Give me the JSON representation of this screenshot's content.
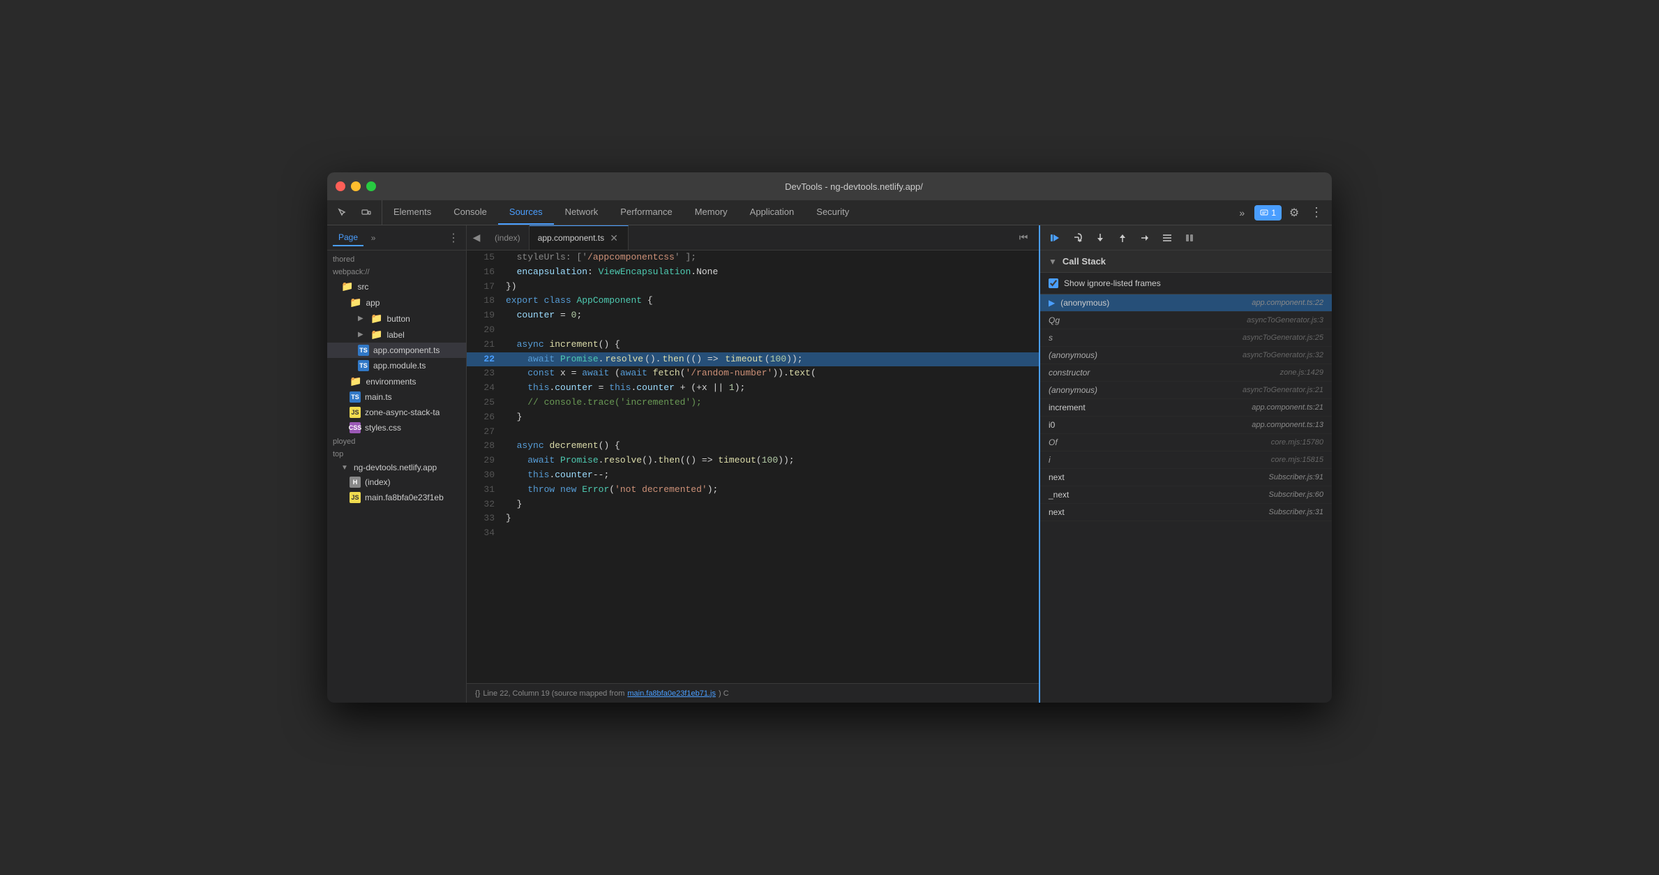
{
  "window": {
    "title": "DevTools - ng-devtools.netlify.app/"
  },
  "traffic_lights": {
    "red": "red",
    "yellow": "yellow",
    "green": "green"
  },
  "devtools": {
    "tabs": [
      {
        "id": "elements",
        "label": "Elements",
        "active": false
      },
      {
        "id": "console",
        "label": "Console",
        "active": false
      },
      {
        "id": "sources",
        "label": "Sources",
        "active": true
      },
      {
        "id": "network",
        "label": "Network",
        "active": false
      },
      {
        "id": "performance",
        "label": "Performance",
        "active": false
      },
      {
        "id": "memory",
        "label": "Memory",
        "active": false
      },
      {
        "id": "application",
        "label": "Application",
        "active": false
      },
      {
        "id": "security",
        "label": "Security",
        "active": false
      }
    ],
    "more_tabs": "»",
    "message_badge": "1",
    "settings_icon": "⚙",
    "more_icon": "⋮"
  },
  "sidebar": {
    "tab_label": "Page",
    "more": "»",
    "menu_icon": "⋮",
    "items": [
      {
        "id": "thored",
        "label": "thored",
        "type": "section",
        "indent": 0
      },
      {
        "id": "webpack",
        "label": "webpack://",
        "type": "section",
        "indent": 0
      },
      {
        "id": "src",
        "label": "src",
        "type": "folder",
        "indent": 1
      },
      {
        "id": "app",
        "label": "app",
        "type": "folder",
        "indent": 2
      },
      {
        "id": "button",
        "label": "button",
        "type": "folder-collapsed",
        "indent": 3
      },
      {
        "id": "label",
        "label": "label",
        "type": "folder-collapsed",
        "indent": 3
      },
      {
        "id": "app-component-ts",
        "label": "app.component.ts",
        "type": "file-ts",
        "indent": 3,
        "active": true
      },
      {
        "id": "app-module-ts",
        "label": "app.module.ts",
        "type": "file-ts",
        "indent": 3
      },
      {
        "id": "environments",
        "label": "environments",
        "type": "folder",
        "indent": 2
      },
      {
        "id": "main-ts",
        "label": "main.ts",
        "type": "file-ts",
        "indent": 2
      },
      {
        "id": "zone-async",
        "label": "zone-async-stack-ta",
        "type": "file-js",
        "indent": 2
      },
      {
        "id": "styles-css",
        "label": "styles.css",
        "type": "file-css",
        "indent": 2
      },
      {
        "id": "ployed",
        "label": "ployed",
        "type": "section",
        "indent": 0
      },
      {
        "id": "top",
        "label": "top",
        "type": "section",
        "indent": 0
      },
      {
        "id": "ng-devtools",
        "label": "ng-devtools.netlify.app",
        "type": "domain",
        "indent": 1
      },
      {
        "id": "index",
        "label": "(index)",
        "type": "file-html",
        "indent": 2
      },
      {
        "id": "main-fa8",
        "label": "main.fa8bfa0e23f1eb",
        "type": "file-js",
        "indent": 2
      }
    ]
  },
  "editor": {
    "tabs": [
      {
        "id": "index",
        "label": "(index)",
        "active": false,
        "closeable": false
      },
      {
        "id": "app-component",
        "label": "app.component.ts",
        "active": true,
        "closeable": true
      }
    ],
    "lines": [
      {
        "num": 15,
        "content": "  styleUrls: ['./appcomponentcss']",
        "type": "comment-partial"
      },
      {
        "num": 16,
        "content": "  encapsulation: ViewEncapsulation.None"
      },
      {
        "num": 17,
        "content": "})"
      },
      {
        "num": 18,
        "content": "export class AppComponent {",
        "keyword": true
      },
      {
        "num": 19,
        "content": "  counter = 0;"
      },
      {
        "num": 20,
        "content": ""
      },
      {
        "num": 21,
        "content": "  async increment() {",
        "keyword": true
      },
      {
        "num": 22,
        "content": "    await Promise.resolve().then(() => timeout(100));",
        "highlighted": true,
        "breakpoint": true
      },
      {
        "num": 23,
        "content": "    const x = await (await fetch('/random-number')).text("
      },
      {
        "num": 24,
        "content": "    this.counter = this.counter + (+x || 1);"
      },
      {
        "num": 25,
        "content": "    // console.trace('incremented');"
      },
      {
        "num": 26,
        "content": "  }"
      },
      {
        "num": 27,
        "content": ""
      },
      {
        "num": 28,
        "content": "  async decrement() {",
        "keyword": true
      },
      {
        "num": 29,
        "content": "    await Promise.resolve().then(() => timeout(100));"
      },
      {
        "num": 30,
        "content": "    this.counter--;"
      },
      {
        "num": 31,
        "content": "    throw new Error('not decremented');"
      },
      {
        "num": 32,
        "content": "  }"
      },
      {
        "num": 33,
        "content": "}"
      },
      {
        "num": 34,
        "content": ""
      }
    ]
  },
  "status_bar": {
    "icon": "{}",
    "text": "Line 22, Column 19 (source mapped from ",
    "link": "main.fa8bfa0e23f1eb71.js",
    "text2": ") C"
  },
  "call_stack": {
    "title": "Call Stack",
    "show_ignore": "Show ignore-listed frames",
    "items": [
      {
        "id": "anonymous-1",
        "name": "(anonymous)",
        "file": "app.component.ts:22",
        "active": true,
        "italic": false
      },
      {
        "id": "qg",
        "name": "Qg",
        "file": "asyncToGenerator.js:3",
        "active": false,
        "italic": true
      },
      {
        "id": "s",
        "name": "s",
        "file": "asyncToGenerator.js:25",
        "active": false,
        "italic": true
      },
      {
        "id": "anonymous-2",
        "name": "(anonymous)",
        "file": "asyncToGenerator.js:32",
        "active": false,
        "italic": true
      },
      {
        "id": "constructor",
        "name": "constructor",
        "file": "zone.js:1429",
        "active": false,
        "italic": true
      },
      {
        "id": "anonymous-3",
        "name": "(anonymous)",
        "file": "asyncToGenerator.js:21",
        "active": false,
        "italic": true
      },
      {
        "id": "increment",
        "name": "increment",
        "file": "app.component.ts:21",
        "active": false,
        "italic": false
      },
      {
        "id": "i0",
        "name": "i0",
        "file": "app.component.ts:13",
        "active": false,
        "italic": false
      },
      {
        "id": "of",
        "name": "Of",
        "file": "core.mjs:15780",
        "active": false,
        "italic": true
      },
      {
        "id": "i",
        "name": "i",
        "file": "core.mjs:15815",
        "active": false,
        "italic": true
      },
      {
        "id": "next-1",
        "name": "next",
        "file": "Subscriber.js:91",
        "active": false,
        "italic": false
      },
      {
        "id": "_next",
        "name": "_next",
        "file": "Subscriber.js:60",
        "active": false,
        "italic": false
      },
      {
        "id": "next-2",
        "name": "next",
        "file": "Subscriber.js:31",
        "active": false,
        "italic": false
      }
    ]
  }
}
